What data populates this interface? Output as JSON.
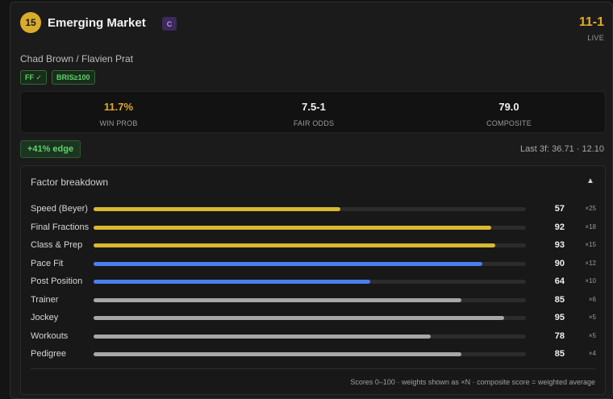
{
  "horse": {
    "number": "15",
    "name": "Emerging Market",
    "class_badge": "C",
    "odds": "11-1",
    "status": "LIVE",
    "connections": "Chad Brown / Flavien Prat",
    "tags": [
      "FF ✓",
      "BRIS≥100"
    ]
  },
  "stats": {
    "win_prob": {
      "value": "11.7%",
      "label": "WIN PROB"
    },
    "fair_odds": {
      "value": "7.5-1",
      "label": "FAIR ODDS"
    },
    "composite": {
      "value": "79.0",
      "label": "COMPOSITE"
    }
  },
  "edge": "+41% edge",
  "last3f": "Last 3f: 36.71 · 12.10",
  "factors": {
    "title": "Factor breakdown",
    "toggle_icon": "▲",
    "items": [
      {
        "label": "Speed (Beyer)",
        "score": 57,
        "weight": "×25",
        "color": "#d9b92f"
      },
      {
        "label": "Final Fractions",
        "score": 92,
        "weight": "×18",
        "color": "#d9b92f"
      },
      {
        "label": "Class & Prep",
        "score": 93,
        "weight": "×15",
        "color": "#d9b92f"
      },
      {
        "label": "Pace Fit",
        "score": 90,
        "weight": "×12",
        "color": "#4a7ff0"
      },
      {
        "label": "Post Position",
        "score": 64,
        "weight": "×10",
        "color": "#4a7ff0"
      },
      {
        "label": "Trainer",
        "score": 85,
        "weight": "×6",
        "color": "#a7a7a7"
      },
      {
        "label": "Jockey",
        "score": 95,
        "weight": "×5",
        "color": "#a7a7a7"
      },
      {
        "label": "Workouts",
        "score": 78,
        "weight": "×5",
        "color": "#a7a7a7"
      },
      {
        "label": "Pedigree",
        "score": 85,
        "weight": "×4",
        "color": "#a7a7a7"
      }
    ],
    "footnote": "Scores 0–100 · weights shown as ×N · composite score = weighted average"
  },
  "colors": {
    "gold": "#e0aa2a",
    "green": "#5fd36a",
    "purple": "#b592ff"
  },
  "icons": {
    "toggle": "chevron-up-icon"
  }
}
